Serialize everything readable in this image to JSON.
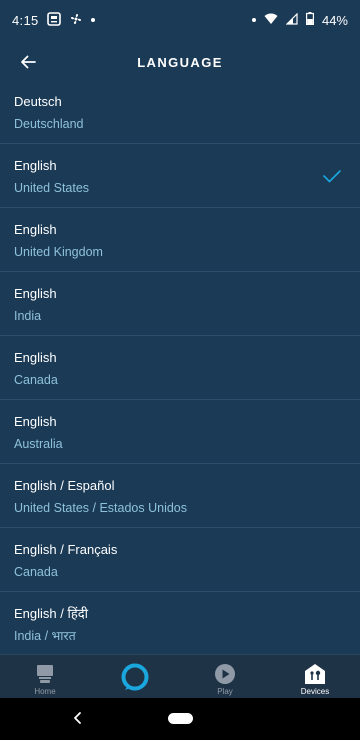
{
  "status_bar": {
    "time": "4:15",
    "battery": "44%"
  },
  "header": {
    "title": "LANGUAGE"
  },
  "languages": [
    {
      "language": "Deutsch",
      "region": "Deutschland",
      "selected": false
    },
    {
      "language": "English",
      "region": "United States",
      "selected": true
    },
    {
      "language": "English",
      "region": "United Kingdom",
      "selected": false
    },
    {
      "language": "English",
      "region": "India",
      "selected": false
    },
    {
      "language": "English",
      "region": "Canada",
      "selected": false
    },
    {
      "language": "English",
      "region": "Australia",
      "selected": false
    },
    {
      "language": "English / Español",
      "region": "United States / Estados Unidos",
      "selected": false
    },
    {
      "language": "English / Français",
      "region": "Canada",
      "selected": false
    },
    {
      "language": "English / हिंदी",
      "region": "India / भारत",
      "selected": false
    }
  ],
  "bottom_nav": {
    "items": [
      {
        "label": "Home",
        "icon": "home-icon",
        "active": false
      },
      {
        "label": "",
        "icon": "alexa-icon",
        "active": false
      },
      {
        "label": "Play",
        "icon": "play-icon",
        "active": false
      },
      {
        "label": "Devices",
        "icon": "devices-icon",
        "active": true
      }
    ]
  },
  "colors": {
    "background": "#1b3a55",
    "accent": "#1aa7de",
    "region_text": "#8ec1dd",
    "divider": "#2d4d6a"
  }
}
